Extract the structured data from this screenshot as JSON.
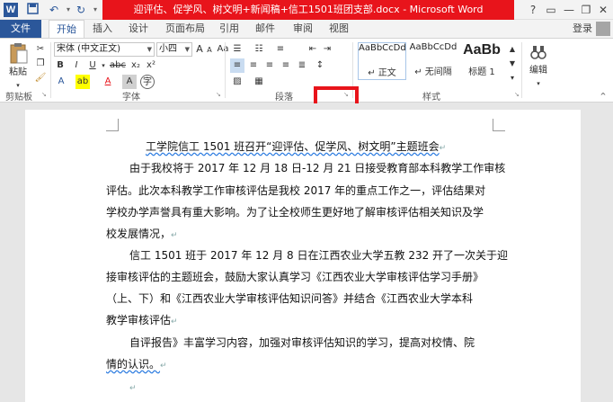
{
  "window": {
    "title": "迎评估、促学风、树文明+新闻稿+信工1501班团支部.docx - Microsoft Word",
    "controls": [
      "?",
      "▭",
      "—",
      "❐",
      "✕"
    ]
  },
  "quick_access": {
    "app_icon": "W",
    "save_icon": "save-icon",
    "undo_icon": "undo-icon",
    "redo_icon": "redo-icon",
    "customize_icon": "customize-icon"
  },
  "tabs": {
    "file": "文件",
    "items": [
      "开始",
      "插入",
      "设计",
      "页面布局",
      "引用",
      "邮件",
      "审阅",
      "视图"
    ],
    "active": "开始",
    "login": "登录"
  },
  "ribbon": {
    "clipboard": {
      "paste": "粘贴",
      "label": "剪贴板"
    },
    "font": {
      "font_name": "宋体 (中文正文)",
      "font_size": "小四",
      "grow": "A",
      "shrink": "A",
      "case": "Aa",
      "clear_format": "A",
      "phonetic": "wén",
      "char_border": "A",
      "bold": "B",
      "italic": "I",
      "underline": "U",
      "strike": "abc",
      "subscript": "x₂",
      "superscript": "x²",
      "text_effect": "A",
      "highlight": "ab",
      "font_color": "A",
      "shading": "A",
      "enclose": "字",
      "label": "字体"
    },
    "paragraph": {
      "label": "段落"
    },
    "styles": {
      "items": [
        {
          "preview": "AaBbCcDd",
          "name": "↵ 正文"
        },
        {
          "preview": "AaBbCcDd",
          "name": "↵ 无间隔"
        },
        {
          "preview": "AaBb",
          "name": "标题 1"
        }
      ],
      "label": "样式"
    },
    "editing": {
      "label": "编辑"
    }
  },
  "document": {
    "paragraphs": [
      {
        "text": "工学院信工 1501 班召开“迎评估、促学风、树文明”主题班会",
        "mark": "↵"
      },
      {
        "text": "由于我校将于 2017 年 12 月 18 日-12 月 21 日接受教育部本科教学工作审核",
        "mark": ""
      },
      {
        "text": "评估。此次本科教学工作审核评估是我校 2017 年的重点工作之一，评估结果对",
        "mark": ""
      },
      {
        "text": "学校办学声誉具有重大影响。为了让全校师生更好地了解审核评估相关知识及学",
        "mark": ""
      },
      {
        "text": "校发展情况，",
        "mark": "↵"
      },
      {
        "text": "信工 1501 班于 2017 年 12 月 8 日在江西农业大学五教 232 开了一次关于迎",
        "mark": ""
      },
      {
        "text": "接审核评估的主题班会，鼓励大家认真学习《江西农业大学审核评估学习手册》",
        "mark": ""
      },
      {
        "text": "（上、下）和《江西农业大学审核评估知识问答》并结合《江西农业大学本科",
        "mark": ""
      },
      {
        "text": "教学审核评估",
        "mark": "↵"
      },
      {
        "text": "自评报告》丰富学习内容，加强对审核评估知识的学习，提高对校情、院",
        "mark": ""
      },
      {
        "text": "情的认识。",
        "mark": "↵"
      },
      {
        "text": "",
        "mark": "↵"
      }
    ]
  }
}
